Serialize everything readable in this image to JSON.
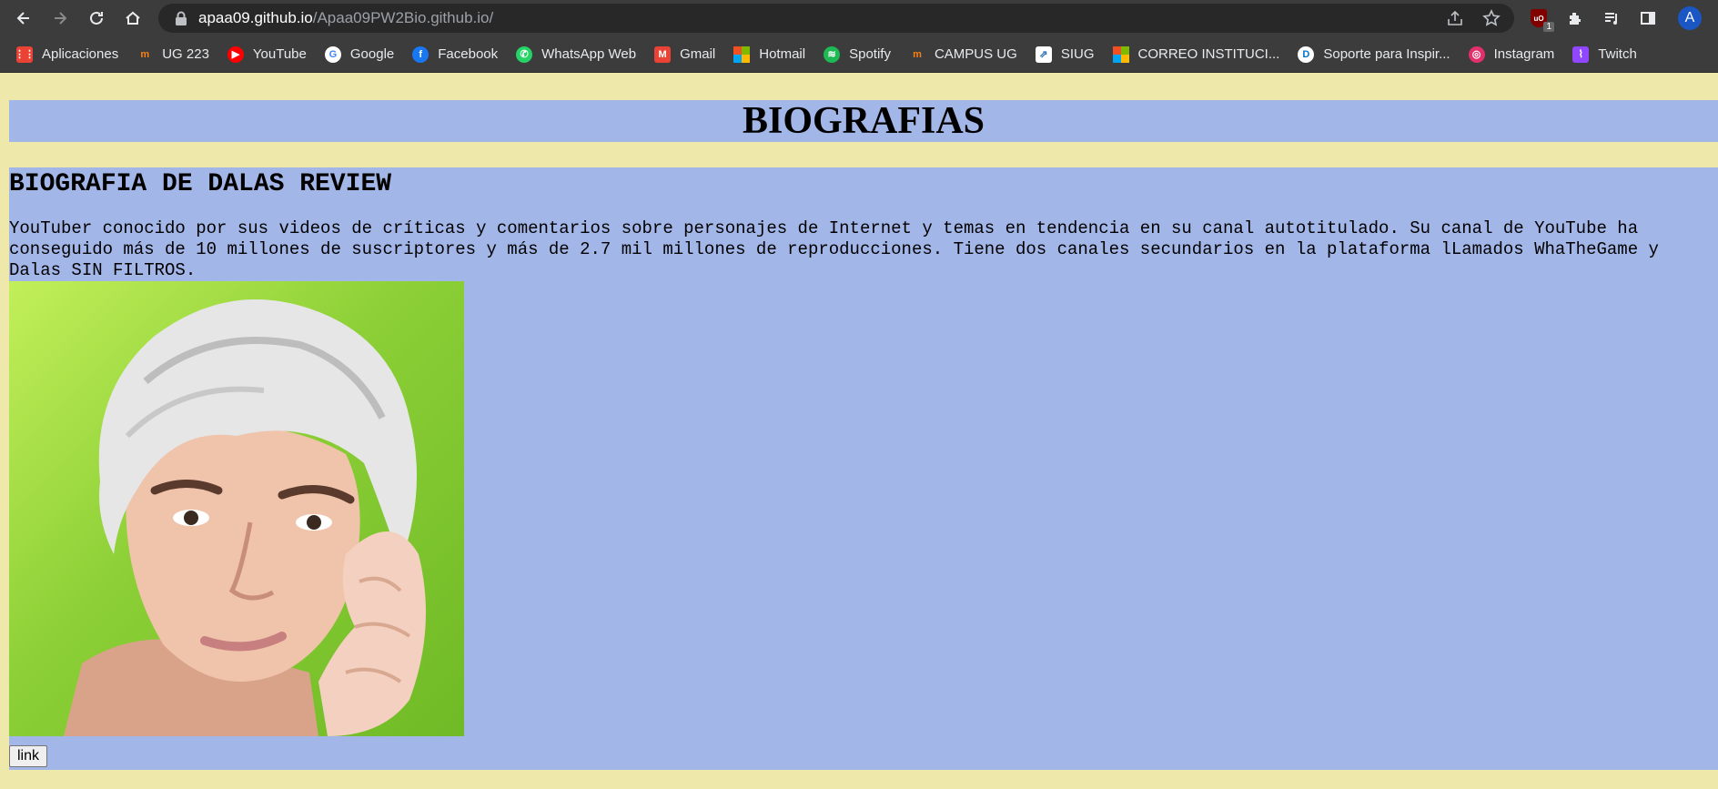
{
  "browser": {
    "url_host": "apaa09.github.io",
    "url_path": "/Apaa09PW2Bio.github.io/",
    "extension_badge": "1",
    "profile_initial": "A",
    "bookmarks": [
      {
        "label": "Aplicaciones",
        "icon": "apps-grid-icon",
        "color": "#ea4335"
      },
      {
        "label": "UG 223",
        "icon": "moodle-icon",
        "color": "#f98012"
      },
      {
        "label": "YouTube",
        "icon": "youtube-icon",
        "color": "#ff0000"
      },
      {
        "label": "Google",
        "icon": "google-icon",
        "color": "#4285f4"
      },
      {
        "label": "Facebook",
        "icon": "facebook-icon",
        "color": "#1877f2"
      },
      {
        "label": "WhatsApp Web",
        "icon": "whatsapp-icon",
        "color": "#25d366"
      },
      {
        "label": "Gmail",
        "icon": "gmail-icon",
        "color": "#ea4335"
      },
      {
        "label": "Hotmail",
        "icon": "microsoft-icon",
        "color": "#f25022"
      },
      {
        "label": "Spotify",
        "icon": "spotify-icon",
        "color": "#1db954"
      },
      {
        "label": "CAMPUS UG",
        "icon": "moodle-icon",
        "color": "#f98012"
      },
      {
        "label": "SIUG",
        "icon": "siug-icon",
        "color": "#dddddd"
      },
      {
        "label": "CORREO INSTITUCI...",
        "icon": "microsoft-icon",
        "color": "#f25022"
      },
      {
        "label": "Soporte para Inspir...",
        "icon": "dell-icon",
        "color": "#0076ce"
      },
      {
        "label": "Instagram",
        "icon": "instagram-icon",
        "color": "#e1306c"
      },
      {
        "label": "Twitch",
        "icon": "twitch-icon",
        "color": "#9146ff"
      }
    ]
  },
  "page": {
    "title": "BIOGRAFIAS",
    "bio_heading": "BIOGRAFIA DE DALAS REVIEW",
    "bio_text": "YouTuber conocido por sus videos de críticas y comentarios sobre personajes de Internet y temas en tendencia en su canal autotitulado. Su canal de YouTube ha conseguido más de 10 millones de suscriptores y más de 2.7 mil millones de reproducciones. Tiene dos canales secundarios en la plataforma lLamados WhaTheGame y Dalas SIN FILTROS.",
    "link_button": "link"
  },
  "colors": {
    "page_background": "#eee8aa",
    "section_background": "#a3b6e8",
    "chrome_background": "#3c3c3c"
  }
}
